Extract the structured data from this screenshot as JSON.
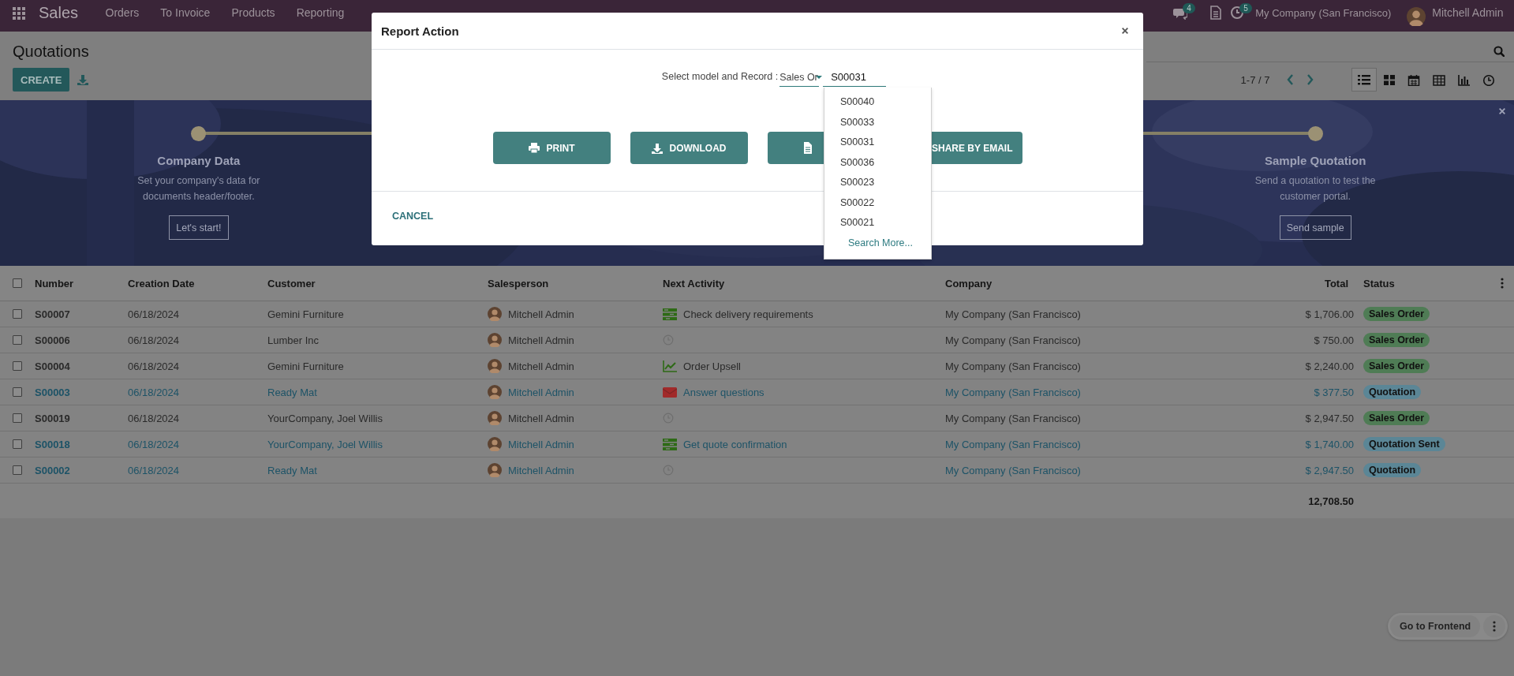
{
  "navbar": {
    "app": "Sales",
    "menu": [
      "Orders",
      "To Invoice",
      "Products",
      "Reporting"
    ],
    "messages_badge": "4",
    "activities_badge": "5",
    "company": "My Company (San Francisco)",
    "user": "Mitchell Admin"
  },
  "control_panel": {
    "title": "Quotations",
    "create": "CREATE",
    "pager": "1-7 / 7",
    "views": [
      {
        "kind": "list",
        "selected": true
      },
      {
        "kind": "kanban",
        "selected": false
      },
      {
        "kind": "calendar",
        "selected": false
      },
      {
        "kind": "pivot",
        "selected": false
      },
      {
        "kind": "graph",
        "selected": false
      },
      {
        "kind": "activity",
        "selected": false
      }
    ]
  },
  "onboarding": {
    "first_step": {
      "title": "Company Data",
      "description": "Set your company's data for documents header/footer.",
      "button": "Let's start!"
    },
    "last_step": {
      "title": "Sample Quotation",
      "description": "Send a quotation to test the customer portal.",
      "button": "Send sample"
    }
  },
  "table": {
    "columns": [
      "Number",
      "Creation Date",
      "Customer",
      "Salesperson",
      "Next Activity",
      "Company",
      "Total",
      "Status"
    ],
    "select_all_checked": false,
    "rows": [
      {
        "checked": false,
        "kind": "sale",
        "number": "S00007",
        "date": "06/18/2024",
        "customer": "Gemini Furniture",
        "salesperson": "Mitchell Admin",
        "activity": {
          "kind": "todo",
          "text": "Check delivery requirements"
        },
        "company": "My Company (San Francisco)",
        "total": "$ 1,706.00",
        "status": "Sales Order"
      },
      {
        "checked": false,
        "kind": "sale",
        "number": "S00006",
        "date": "06/18/2024",
        "customer": "Lumber Inc",
        "salesperson": "Mitchell Admin",
        "activity": {
          "kind": "none"
        },
        "company": "My Company (San Francisco)",
        "total": "$ 750.00",
        "status": "Sales Order"
      },
      {
        "checked": false,
        "kind": "sale",
        "number": "S00004",
        "date": "06/18/2024",
        "customer": "Gemini Furniture",
        "salesperson": "Mitchell Admin",
        "activity": {
          "kind": "upsell",
          "text": "Order Upsell"
        },
        "company": "My Company (San Francisco)",
        "total": "$ 2,240.00",
        "status": "Sales Order"
      },
      {
        "checked": false,
        "kind": "quotation",
        "number": "S00003",
        "date": "06/18/2024",
        "customer": "Ready Mat",
        "salesperson": "Mitchell Admin",
        "activity": {
          "kind": "email",
          "text": "Answer questions"
        },
        "company": "My Company (San Francisco)",
        "total": "$ 377.50",
        "status": "Quotation"
      },
      {
        "checked": false,
        "kind": "sale",
        "number": "S00019",
        "date": "06/18/2024",
        "customer": "YourCompany, Joel Willis",
        "salesperson": "Mitchell Admin",
        "activity": {
          "kind": "none"
        },
        "company": "My Company (San Francisco)",
        "total": "$ 2,947.50",
        "status": "Sales Order"
      },
      {
        "checked": false,
        "kind": "quotation",
        "number": "S00018",
        "date": "06/18/2024",
        "customer": "YourCompany, Joel Willis",
        "salesperson": "Mitchell Admin",
        "activity": {
          "kind": "todo",
          "text": "Get quote confirmation"
        },
        "company": "My Company (San Francisco)",
        "total": "$ 1,740.00",
        "status": "Quotation Sent"
      },
      {
        "checked": false,
        "kind": "quotation",
        "number": "S00002",
        "date": "06/18/2024",
        "customer": "Ready Mat",
        "salesperson": "Mitchell Admin",
        "activity": {
          "kind": "none"
        },
        "company": "My Company (San Francisco)",
        "total": "$ 2,947.50",
        "status": "Quotation"
      }
    ],
    "total": "12,708.50"
  },
  "dialog": {
    "title": "Report Action",
    "prompt": "Select model and Record :",
    "model": "Sales Or",
    "record": "S00031",
    "buttons": [
      {
        "kind": "print",
        "label": "PRINT"
      },
      {
        "kind": "document"
      },
      {
        "kind": "email",
        "label": "SHARE BY EMAIL"
      }
    ],
    "download": "DOWNLOAD",
    "cancel": "CANCEL",
    "suggestions": [
      "S00040",
      "S00033",
      "S00031",
      "S00036",
      "S00023",
      "S00022",
      "S00021"
    ],
    "search_more": "Search More..."
  },
  "frontend_button": "Go to Frontend"
}
